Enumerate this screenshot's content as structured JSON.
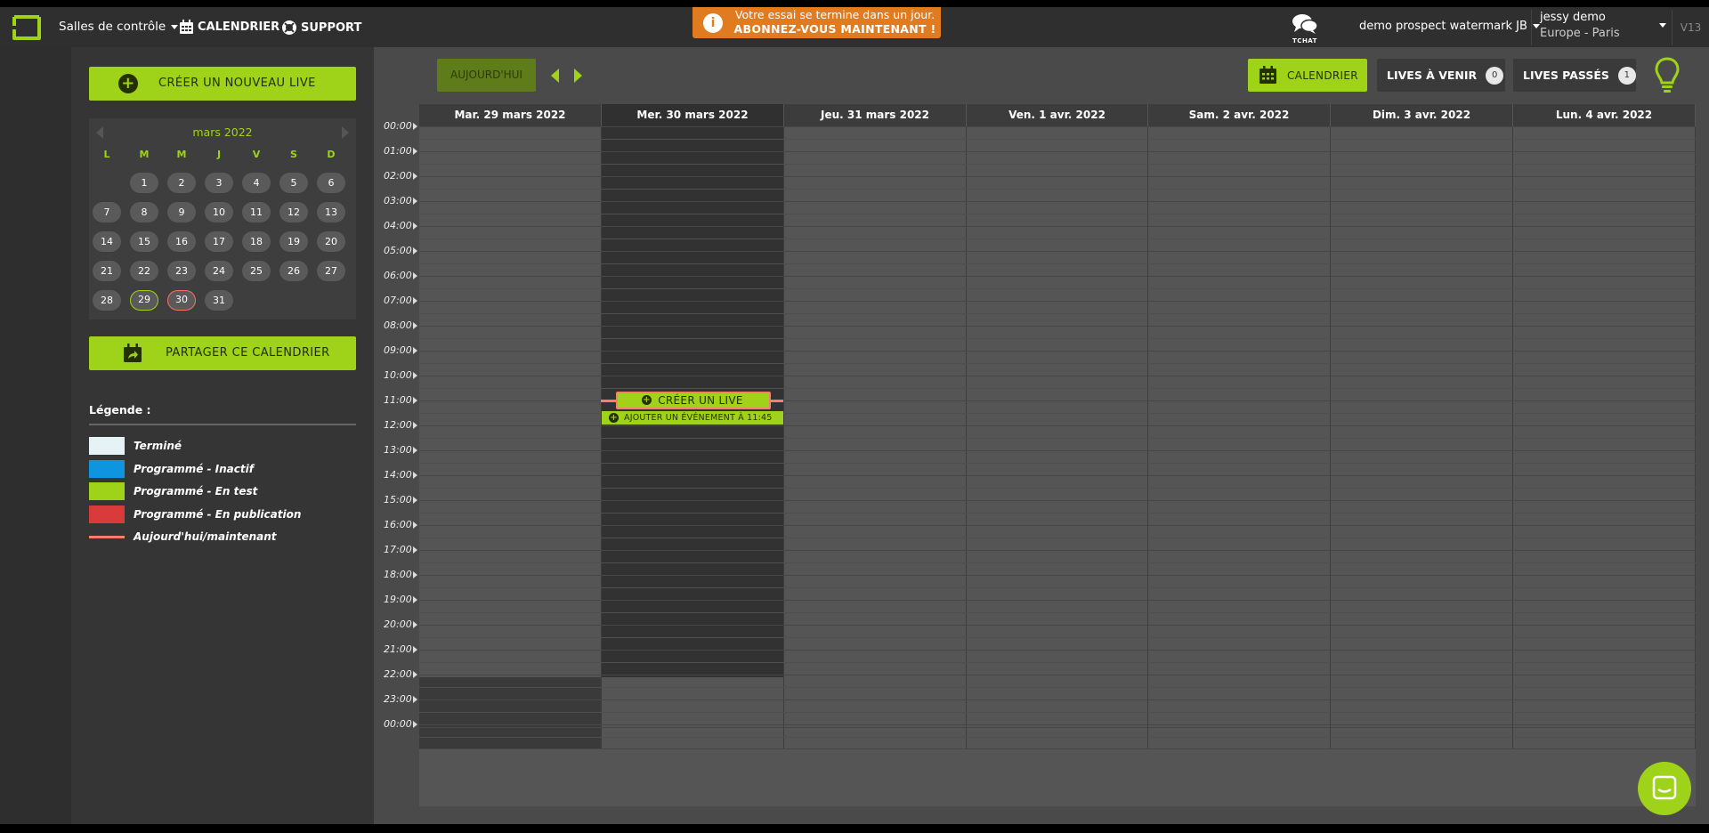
{
  "topbar": {
    "control_rooms": "Salles de contrôle",
    "calendar": "CALENDRIER",
    "support": "SUPPORT",
    "trial_line1": "Votre essai se termine dans un jour.",
    "trial_line2": "ABONNEZ-VOUS MAINTENANT !",
    "chat_label": "TCHAT",
    "account": "demo prospect watermark JB",
    "user_name": "jessy demo",
    "user_timezone": "Europe - Paris",
    "version": "V13",
    "icons": [
      "logo-icon",
      "calendar-icon",
      "lifebuoy-icon",
      "info-icon",
      "chat-bubbles-icon"
    ]
  },
  "sidebar": {
    "create_live": "CRÉER UN NOUVEAU LIVE",
    "minical": {
      "month": "mars 2022",
      "weekdays": [
        "L",
        "M",
        "M",
        "J",
        "V",
        "S",
        "D"
      ],
      "start_offset": 1,
      "days": [
        "1",
        "2",
        "3",
        "4",
        "5",
        "6",
        "7",
        "8",
        "9",
        "10",
        "11",
        "12",
        "13",
        "14",
        "15",
        "16",
        "17",
        "18",
        "19",
        "20",
        "21",
        "22",
        "23",
        "24",
        "25",
        "26",
        "27",
        "28",
        "29",
        "30",
        "31"
      ],
      "selected": "29",
      "today": "30"
    },
    "share_calendar": "PARTAGER CE CALENDRIER",
    "legend": {
      "title": "Légende :",
      "items": [
        {
          "label": "Terminé",
          "color": "#e6f3f6"
        },
        {
          "label": "Programmé - Inactif",
          "color": "#0d95e0"
        },
        {
          "label": "Programmé - En test",
          "color": "#9fd319"
        },
        {
          "label": "Programmé - En publication",
          "color": "#d93a3a"
        },
        {
          "label": "Aujourd'hui/maintenant",
          "color": "#ff7b6b",
          "line": true
        }
      ]
    }
  },
  "toolbar": {
    "today": "AUJOURD'HUI",
    "calendar": "CALENDRIER",
    "upcoming": "LIVES À VENIR",
    "upcoming_count": "0",
    "past": "LIVES PASSÉS",
    "past_count": "1"
  },
  "calendar": {
    "days": [
      {
        "label": "Mar. 29 mars 2022"
      },
      {
        "label": "Mer. 30 mars 2022",
        "today": true
      },
      {
        "label": "Jeu. 31 mars 2022"
      },
      {
        "label": "Ven. 1 avr. 2022"
      },
      {
        "label": "Sam. 2 avr. 2022"
      },
      {
        "label": "Dim. 3 avr. 2022"
      },
      {
        "label": "Lun. 4 avr. 2022"
      }
    ],
    "hours": [
      "00:00",
      "01:00",
      "02:00",
      "03:00",
      "04:00",
      "05:00",
      "06:00",
      "07:00",
      "08:00",
      "09:00",
      "10:00",
      "11:00",
      "12:00",
      "13:00",
      "14:00",
      "15:00",
      "16:00",
      "17:00",
      "18:00",
      "19:00",
      "20:00",
      "21:00",
      "22:00",
      "23:00",
      "00:00"
    ],
    "create_live_slot": "CRÉER UN LIVE",
    "add_event": "AJOUTER UN ÉVÉNEMENT À 11:45",
    "now_time": "11:00"
  },
  "colors": {
    "accent": "#9fd319",
    "trial": "#e07b1f",
    "now_line": "#ff7b6b"
  }
}
